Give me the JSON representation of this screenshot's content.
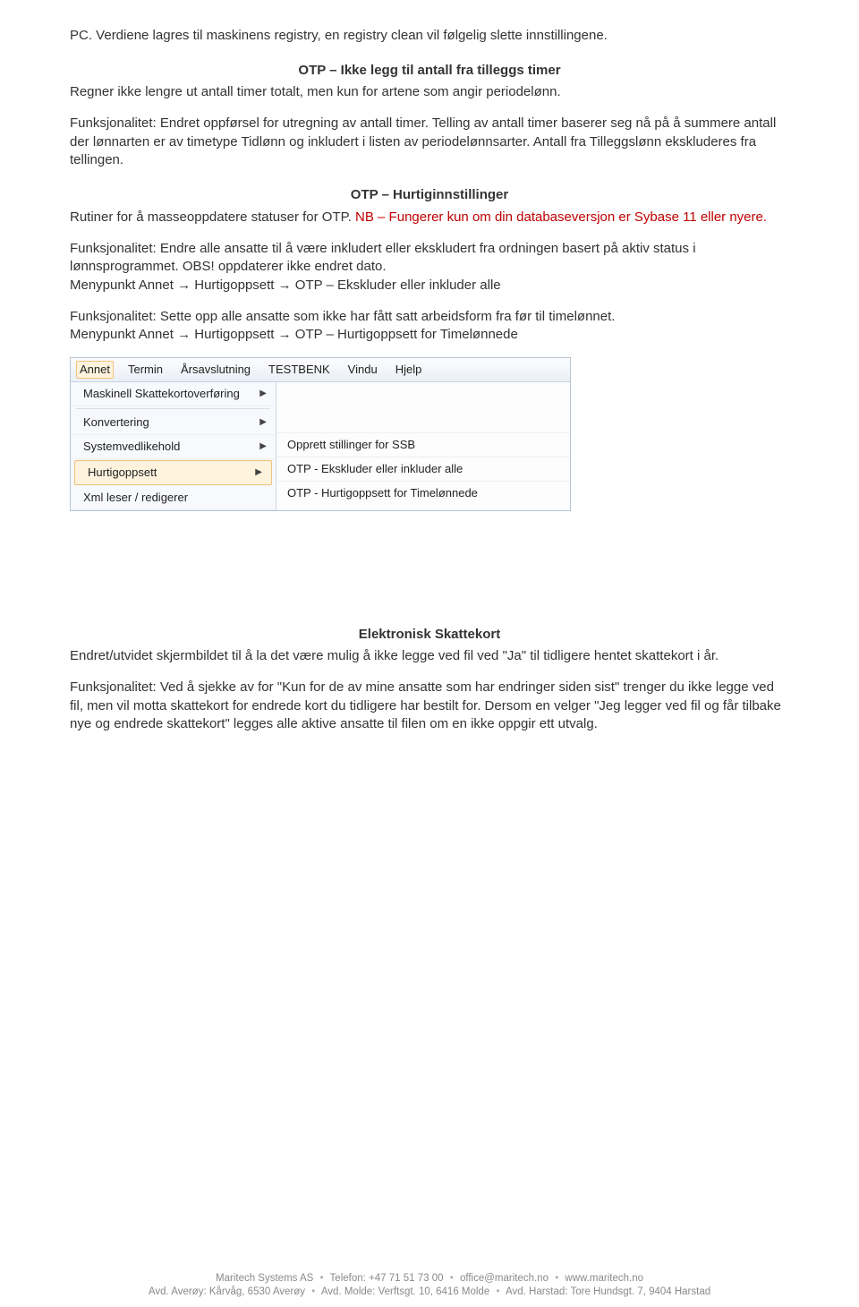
{
  "para1": "PC. Verdiene lagres til maskinens registry, en registry clean vil følgelig slette innstillingene.",
  "heading1": "OTP – Ikke legg til antall fra tilleggs timer",
  "para2": "Regner ikke lengre ut antall timer totalt, men kun for artene som angir periodelønn.",
  "para3": "Funksjonalitet: Endret oppførsel for utregning av antall timer. Telling av antall timer baserer seg nå på å summere antall der lønnarten er av timetype Tidlønn og inkludert i listen av periodelønnsarter. Antall fra Tilleggslønn ekskluderes fra tellingen.",
  "heading2": "OTP – Hurtiginnstillinger",
  "para4a": "Rutiner for å masseoppdatere statuser for OTP. ",
  "para4b": "NB – Fungerer kun om din databaseversjon er Sybase 11 eller nyere.",
  "para5": "Funksjonalitet: Endre alle ansatte til å være inkludert eller ekskludert fra ordningen basert på aktiv status i lønnsprogrammet. OBS! oppdaterer ikke endret dato.\nMenypunkt Annet → Hurtigoppsett → OTP – Ekskluder eller inkluder alle",
  "para6": "Funksjonalitet: Sette opp alle ansatte som ikke har fått satt arbeidsform fra før til timelønnet.\nMenypunkt Annet → Hurtigoppsett → OTP – Hurtigoppsett for Timelønnede",
  "menubar": {
    "items": [
      "Annet",
      "Termin",
      "Årsavslutning",
      "TESTBENK",
      "Vindu",
      "Hjelp"
    ]
  },
  "leftmenu": {
    "items": [
      "Maskinell Skattekortoverføring",
      "Konvertering",
      "Systemvedlikehold",
      "Hurtigoppsett",
      "Xml leser / redigerer"
    ]
  },
  "submenu": {
    "items": [
      "Opprett stillinger for SSB",
      "OTP - Ekskluder eller inkluder alle",
      "OTP - Hurtigoppsett for Timelønnede"
    ]
  },
  "heading3": "Elektronisk Skattekort",
  "para7": "Endret/utvidet skjermbildet til å la det være mulig å ikke legge ved fil ved \"Ja\" til tidligere hentet skattekort i år.",
  "para8": "Funksjonalitet: Ved å sjekke av for \"Kun for de av mine ansatte som har endringer siden sist\" trenger du ikke legge ved fil, men vil motta skattekort for endrede kort du tidligere har bestilt for. Dersom en velger \"Jeg legger ved fil og får tilbake nye og endrede skattekort\" legges alle aktive ansatte til filen om en ikke oppgir ett utvalg.",
  "footer": {
    "company": "Maritech Systems AS",
    "phone_label": "Telefon:",
    "phone": "+47 71 51 73 00",
    "email": "office@maritech.no",
    "web": "www.maritech.no",
    "addr1_label": "Avd. Averøy:",
    "addr1": "Kårvåg, 6530 Averøy",
    "addr2_label": "Avd. Molde:",
    "addr2": "Verftsgt. 10, 6416 Molde",
    "addr3_label": "Avd. Harstad:",
    "addr3": "Tore Hundsgt. 7, 9404 Harstad"
  }
}
